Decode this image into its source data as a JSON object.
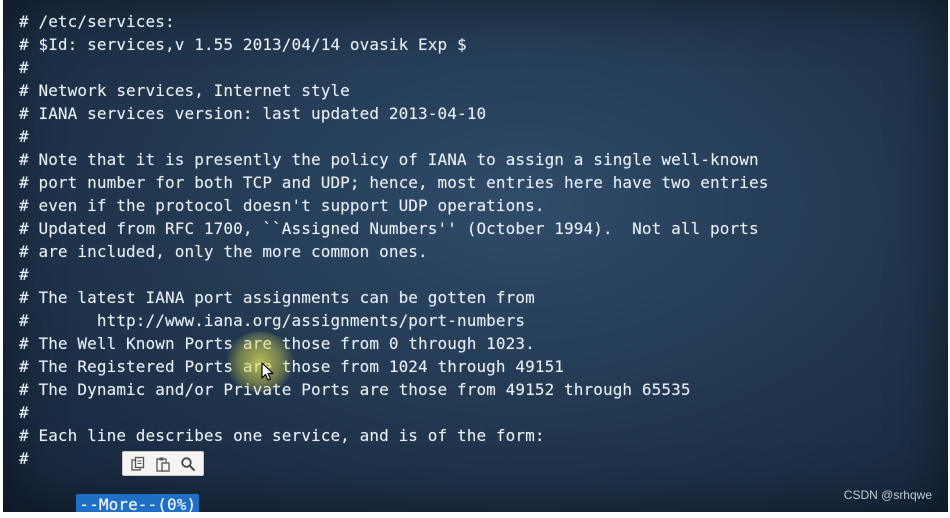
{
  "terminal": {
    "lines": [
      "# /etc/services:",
      "# $Id: services,v 1.55 2013/04/14 ovasik Exp $",
      "#",
      "# Network services, Internet style",
      "# IANA services version: last updated 2013-04-10",
      "#",
      "# Note that it is presently the policy of IANA to assign a single well-known",
      "# port number for both TCP and UDP; hence, most entries here have two entries",
      "# even if the protocol doesn't support UDP operations.",
      "# Updated from RFC 1700, ``Assigned Numbers'' (October 1994).  Not all ports",
      "# are included, only the more common ones.",
      "#",
      "# The latest IANA port assignments can be gotten from",
      "#       http://www.iana.org/assignments/port-numbers",
      "# The Well Known Ports are those from 0 through 1023.",
      "# The Registered Ports are those from 1024 through 49151",
      "# The Dynamic and/or Private Ports are those from 49152 through 65535",
      "#",
      "# Each line describes one service, and is of the form:",
      "#"
    ],
    "pager_status": "--More--(0%)"
  },
  "toolbar": {
    "icons": [
      "copy-icon",
      "paste-icon",
      "search-icon"
    ]
  },
  "watermark": "CSDN @srhqwe",
  "colors": {
    "background": "#233a52",
    "text": "#e8eef6",
    "pager_bg": "#1f6fc6"
  }
}
